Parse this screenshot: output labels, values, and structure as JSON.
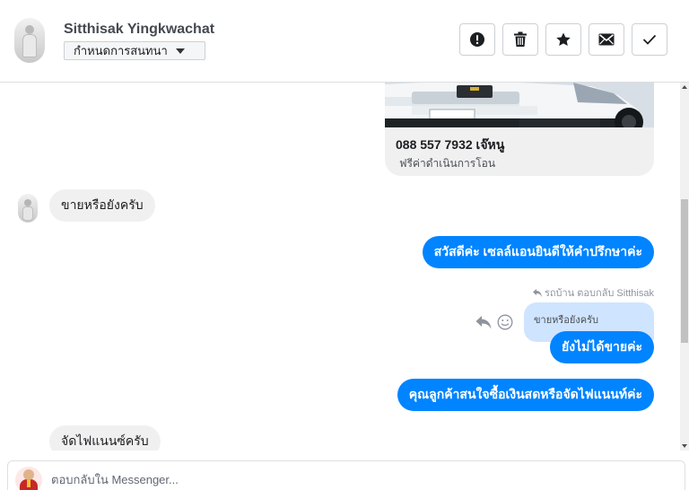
{
  "header": {
    "contact_name": "Sitthisak Yingkwachat",
    "assign_dropdown": {
      "selected": "กำหนดการสนทนา"
    },
    "actions": [
      {
        "name": "mark-spam",
        "icon": "exclamation-icon"
      },
      {
        "name": "delete",
        "icon": "trash-icon"
      },
      {
        "name": "star",
        "icon": "star-icon"
      },
      {
        "name": "mark-unread",
        "icon": "envelope-icon"
      },
      {
        "name": "mark-done",
        "icon": "checkmark-icon"
      }
    ]
  },
  "conversation": {
    "attachment_card": {
      "image": "car-image",
      "title": "088 557 7932 เจ๊หนู",
      "subtitle": "ฟรีค่าดำเนินการโอน"
    },
    "messages": [
      {
        "from": "customer",
        "text": "ขายหรือยังครับ"
      },
      {
        "from": "page",
        "text": "สวัสดีค่ะ เซลล์แอนยินดีให้คำปรึกษาค่ะ"
      },
      {
        "from": "page",
        "reply_meta": "รถบ้าน ตอบกลับ Sitthisak",
        "quoted_text": "ขายหรือยังครับ",
        "text": "ยังไม่ได้ขายค่ะ"
      },
      {
        "from": "page",
        "text": "คุณลูกค้าสนใจซื้อเงินสดหรือจัดไฟแนนท์ค่ะ"
      },
      {
        "from": "customer",
        "text": "จัดไฟแนนซ์ครับ"
      }
    ]
  },
  "composer": {
    "placeholder": "ตอบกลับใน Messenger...",
    "value": ""
  },
  "colors": {
    "outgoing_bubble": "#0084ff",
    "incoming_bubble": "#f1f0f0",
    "quoted_bubble": "#cfe4ff"
  }
}
